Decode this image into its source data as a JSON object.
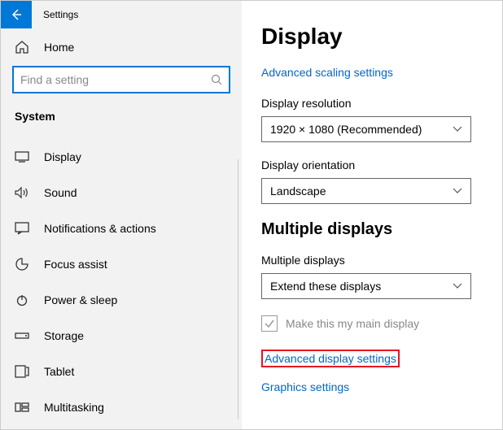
{
  "titlebar": {
    "label": "Settings"
  },
  "home": {
    "label": "Home"
  },
  "search": {
    "placeholder": "Find a setting"
  },
  "section": {
    "label": "System"
  },
  "nav": [
    {
      "label": "Display"
    },
    {
      "label": "Sound"
    },
    {
      "label": "Notifications & actions"
    },
    {
      "label": "Focus assist"
    },
    {
      "label": "Power & sleep"
    },
    {
      "label": "Storage"
    },
    {
      "label": "Tablet"
    },
    {
      "label": "Multitasking"
    }
  ],
  "page": {
    "title": "Display",
    "scaling_link": "Advanced scaling settings",
    "resolution_label": "Display resolution",
    "resolution_value": "1920 × 1080 (Recommended)",
    "orientation_label": "Display orientation",
    "orientation_value": "Landscape",
    "multiple_heading": "Multiple displays",
    "multiple_label": "Multiple displays",
    "multiple_value": "Extend these displays",
    "main_display_label": "Make this my main display",
    "advanced_link": "Advanced display settings",
    "graphics_link": "Graphics settings"
  }
}
